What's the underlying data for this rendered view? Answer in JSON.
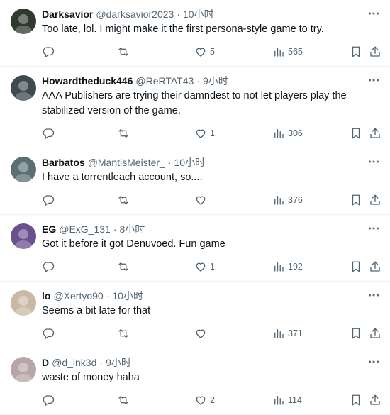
{
  "tweets": [
    {
      "name": "Darksavior",
      "handle": "@darksavior2023",
      "time": "10小时",
      "text": "Too late, lol. I might make it the first persona-style game to try.",
      "replies": "",
      "retweets": "",
      "likes": "5",
      "views": "565",
      "avatar_color": "#2f3a2c"
    },
    {
      "name": "Howardtheduck446",
      "handle": "@ReRTAT43",
      "time": "9小时",
      "text": "AAA Publishers are trying their damndest to not let players play the stabilized version of the game.",
      "replies": "",
      "retweets": "",
      "likes": "1",
      "views": "306",
      "avatar_color": "#3d4a4f"
    },
    {
      "name": "Barbatos",
      "handle": "@MantisMeister_",
      "time": "10小时",
      "text": "I have a torrentleach account, so....",
      "replies": "",
      "retweets": "",
      "likes": "",
      "views": "376",
      "avatar_color": "#5d6f73"
    },
    {
      "name": "EG",
      "handle": "@ExG_131",
      "time": "8小时",
      "text": "Got it before it got Denuvoed. Fun game",
      "replies": "",
      "retweets": "",
      "likes": "1",
      "views": "192",
      "avatar_color": "#6b4f8f"
    },
    {
      "name": "lo",
      "handle": "@Xertyo90",
      "time": "10小时",
      "text": "Seems a bit late for that",
      "replies": "",
      "retweets": "",
      "likes": "",
      "views": "371",
      "avatar_color": "#c9b9a4"
    },
    {
      "name": "D",
      "handle": "@d_ink3d",
      "time": "9小时",
      "text": "waste of money haha",
      "replies": "",
      "retweets": "",
      "likes": "2",
      "views": "114",
      "avatar_color": "#b7a6a8"
    }
  ]
}
